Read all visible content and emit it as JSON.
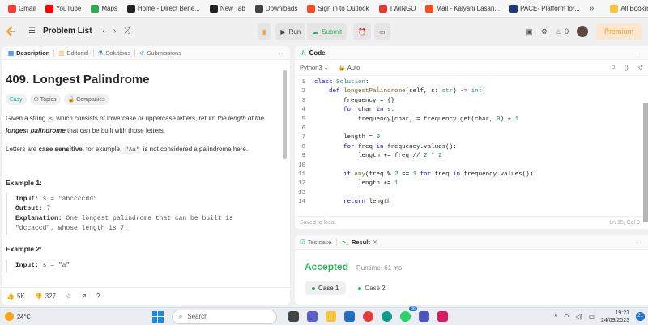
{
  "bookmarks": {
    "items": [
      {
        "label": "Gmail",
        "color": "#ea4335"
      },
      {
        "label": "YouTube",
        "color": "#ff0000"
      },
      {
        "label": "Maps",
        "color": "#34a853"
      },
      {
        "label": "Home - Direct Bene...",
        "color": "#222222"
      },
      {
        "label": "New Tab",
        "color": "#222222"
      },
      {
        "label": "Downloads",
        "color": "#444444"
      },
      {
        "label": "Sign in to Outlook",
        "color": "#f25022"
      },
      {
        "label": "TWINGO",
        "color": "#e53935"
      },
      {
        "label": "Mail - Kalyani Lasan...",
        "color": "#f25022"
      },
      {
        "label": "PACE- Platform for...",
        "color": "#1a3a7a"
      }
    ],
    "more": "»",
    "all_bookmarks": "All Bookmarks"
  },
  "topnav": {
    "problem_list": "Problem List",
    "run": "Run",
    "submit": "Submit",
    "points": "0",
    "premium": "Premium"
  },
  "tabs": {
    "description": "Description",
    "editorial": "Editorial",
    "solutions": "Solutions",
    "submissions": "Submissions"
  },
  "problem": {
    "title": "409. Longest Palindrome",
    "difficulty": "Easy",
    "topics": "Topics",
    "companies": "Companies",
    "p1_a": "Given a string ",
    "p1_code": "s",
    "p1_b": " which consists of lowercase or uppercase letters, return ",
    "p1_c": "the length of the ",
    "p1_d": "longest palindrome",
    "p1_e": " that can be built with those letters.",
    "p2_a": "Letters are ",
    "p2_b": "case sensitive",
    "p2_c": ", for example, ",
    "p2_code": "\"Aa\"",
    "p2_d": " is not considered a palindrome here.",
    "ex1_title": "Example 1:",
    "ex1_input_label": "Input:",
    "ex1_input": " s = \"abccccdd\"",
    "ex1_output_label": "Output:",
    "ex1_output": " 7",
    "ex1_expl_label": "Explanation:",
    "ex1_expl_1": " One longest palindrome that can be built is",
    "ex1_expl_2": "\"dccaccd\", whose length is 7.",
    "ex2_title": "Example 2:",
    "ex2_input_label": "Input:",
    "ex2_input": " s = \"a\""
  },
  "left_footer": {
    "likes": "5K",
    "dislikes": "327"
  },
  "code": {
    "header": "Code",
    "language": "Python3",
    "mode": "Auto",
    "saved": "Saved to local",
    "position": "Ln 15, Col 9"
  },
  "result": {
    "testcase_tab": "Testcase",
    "result_tab": "Result",
    "status": "Accepted",
    "runtime": "Runtime: 61 ms",
    "case1": "Case 1",
    "case2": "Case 2"
  },
  "taskbar": {
    "temperature": "24°C",
    "search": "Search",
    "time": "19:21",
    "date": "24/09/2023",
    "notifications": "21",
    "badge": "38"
  }
}
